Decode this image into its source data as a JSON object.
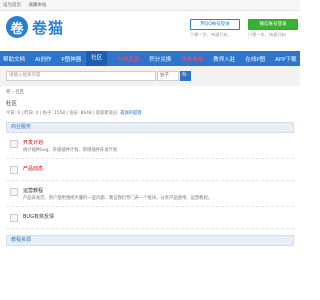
{
  "topbar": {
    "links": [
      "设为首页",
      "收藏本站"
    ]
  },
  "logo": {
    "glyph": "卷",
    "text": "卷猫"
  },
  "login": [
    {
      "label": "用QQ帐号登录",
      "sub": "只需一步，快速开始"
    },
    {
      "label": "微信账号登录",
      "sub": "只需一步，快速开始"
    }
  ],
  "nav": [
    "帮助文档",
    "AI创作",
    "P图神器",
    "社区",
    "付费资源",
    "积分兑换",
    "卷猫商城",
    "教师入驻",
    "在线P图",
    "APP下载"
  ],
  "search": {
    "placeholder": "请输入搜索内容",
    "type": "帖子",
    "button": "🔍"
  },
  "breadcrumb": "卷 › 社区",
  "page": {
    "title": "社区"
  },
  "stats": {
    "today": "今日: 0",
    "yesterday": "昨日: 0",
    "posts": "帖子: 1558",
    "members": "会员: 8648",
    "newest_label": "欢迎新会员:",
    "newest": "孤独的狐狸"
  },
  "sections": [
    {
      "title": "商业服务",
      "forums": [
        {
          "name": "开发计划",
          "desc": "统计插件bug、升级插件计划、新增插件开发计划"
        },
        {
          "name": "产品动态",
          "desc": ""
        },
        {
          "name": "运营教程",
          "desc": "产品开发完、用户使用围绕大量的一些问题、我这我们专门开一个板块，分享产品使用、运营教程。"
        },
        {
          "name": "BUG有奖反馈",
          "desc": ""
        }
      ]
    },
    {
      "title": "教程资源",
      "forums": []
    }
  ]
}
